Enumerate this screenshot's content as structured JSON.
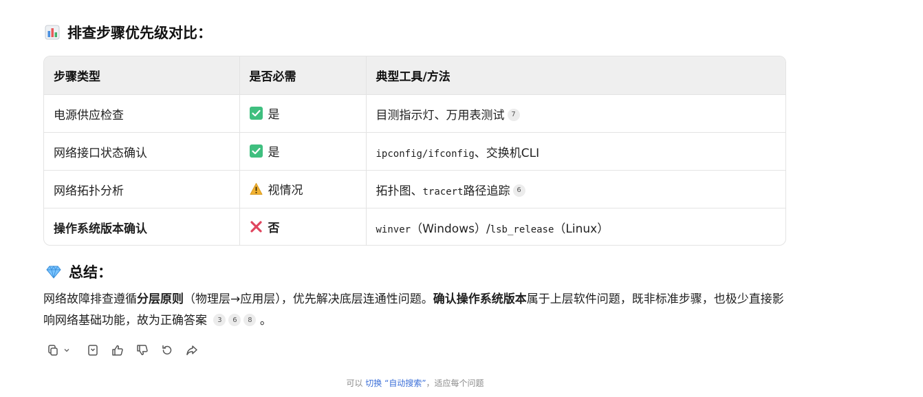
{
  "heading": {
    "icon": "bar-chart-icon",
    "text": "排查步骤优先级对比："
  },
  "table": {
    "headers": [
      "步骤类型",
      "是否必需",
      "典型工具/方法"
    ],
    "rows": [
      {
        "step": "电源供应检查",
        "status_icon": "check-mark-icon",
        "status": "是",
        "tool": "目测指示灯、万用表测试",
        "cite": "7"
      },
      {
        "step": "网络接口状态确认",
        "status_icon": "check-mark-icon",
        "status": "是",
        "tool_code": "ipconfig/ifconfig",
        "tool_rest": "、交换机CLI"
      },
      {
        "step": "网络拓扑分析",
        "status_icon": "warning-icon",
        "status": "视情况",
        "tool_pre": "拓扑图、",
        "tool_code": "tracert",
        "tool_rest": "路径追踪",
        "cite": "6"
      },
      {
        "step": "操作系统版本确认",
        "status_icon": "cross-mark-icon",
        "status": "否",
        "tool_code": "winver",
        "tool_mid": "（Windows）/",
        "tool_code2": "lsb_release",
        "tool_rest": "（Linux）"
      }
    ]
  },
  "summary": {
    "icon": "gem-icon",
    "title": "总结：",
    "p1": "网络故障排查遵循",
    "b1": "分层原则",
    "p2": "（物理层→应用层），优先解决底层连通性问题。",
    "b2": "确认操作系统版本",
    "p3": "属于上层软件问题，既非标准步骤，也极少直接影响网络基础功能，故为正确答案",
    "cites": [
      "3",
      "6",
      "8"
    ],
    "end": "。"
  },
  "actions": [
    "copy-icon",
    "chevron-down-icon",
    "bookmark-icon",
    "thumbs-up-icon",
    "thumbs-down-icon",
    "regenerate-icon",
    "share-icon"
  ],
  "footer": {
    "pre": "可以 ",
    "link": "切换 “自动搜索”",
    "post": "，适应每个问题"
  },
  "colors": {
    "check": "#3fbf7f",
    "warning": "#f2b233",
    "cross": "#e0455e",
    "link": "#3b6fd8"
  }
}
